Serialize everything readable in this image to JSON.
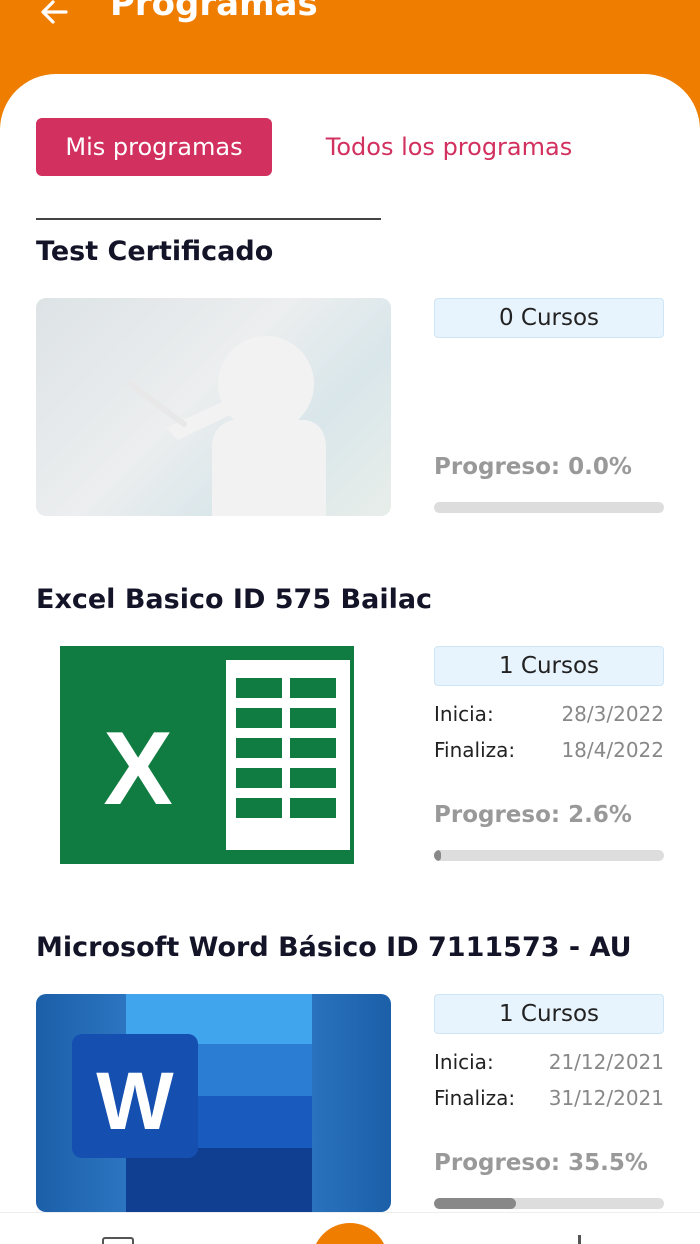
{
  "header": {
    "title": "Programas",
    "back_icon": "arrow-left-icon"
  },
  "tabs": {
    "mine": "Mis programas",
    "all": "Todos los programas"
  },
  "labels": {
    "inicia": "Inicia:",
    "finaliza": "Finaliza:"
  },
  "programs": [
    {
      "title": "Test Certificado",
      "courses": "0 Cursos",
      "progress_label": "Progreso: 0.0%",
      "progress": 0.0,
      "thumbnail": "teacher-placeholder-image"
    },
    {
      "title": "Excel Basico ID 575 Bailac",
      "courses": "1 Cursos",
      "start": "28/3/2022",
      "end": "18/4/2022",
      "progress_label": "Progreso: 2.6%",
      "progress": 2.6,
      "thumbnail": "excel-logo-image"
    },
    {
      "title": "Microsoft Word Básico ID 7111573 - AU",
      "courses": "1 Cursos",
      "start": "21/12/2021",
      "end": "31/12/2021",
      "progress_label": "Progreso: 35.5%",
      "progress": 35.5,
      "thumbnail": "word-logo-image"
    }
  ],
  "bottom_nav": {
    "items": [
      "folder-icon",
      "home-icon",
      "more-icon"
    ]
  },
  "colors": {
    "brand_orange": "#ef7d00",
    "accent_pink": "#d2305f",
    "excel_green": "#107c41",
    "word_blue": "#185abd"
  }
}
